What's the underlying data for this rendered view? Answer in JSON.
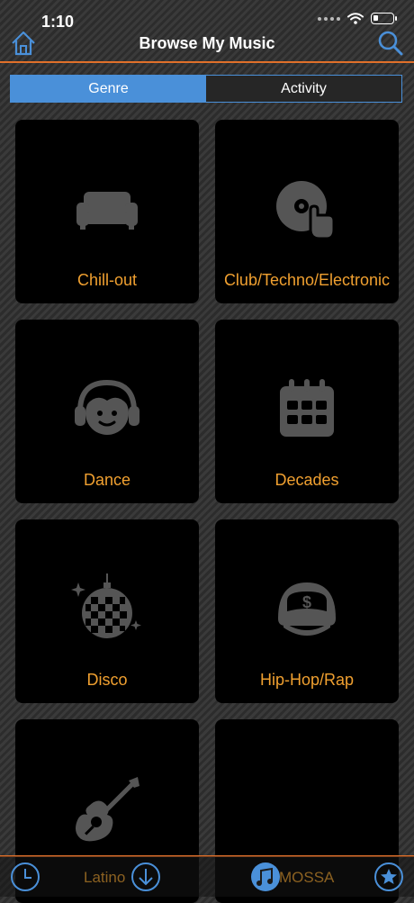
{
  "status_bar": {
    "time": "1:10"
  },
  "nav": {
    "title": "Browse My Music"
  },
  "segmented": {
    "tabs": [
      "Genre",
      "Activity"
    ],
    "selected": "Genre"
  },
  "tiles": [
    {
      "label": "Chill-out",
      "icon": "sofa-icon"
    },
    {
      "label": "Club/Techno/Electronic",
      "icon": "dj-turntable-icon"
    },
    {
      "label": "Dance",
      "icon": "headphones-face-icon"
    },
    {
      "label": "Decades",
      "icon": "calendar-icon"
    },
    {
      "label": "Disco",
      "icon": "disco-ball-icon"
    },
    {
      "label": "Hip-Hop/Rap",
      "icon": "cap-dollar-icon"
    },
    {
      "label": "",
      "icon": "guitar-icon"
    },
    {
      "label": "",
      "icon": ""
    }
  ],
  "bottom_bar": {
    "now_playing_left": "Latino",
    "now_playing_right": "MOSSA"
  },
  "colors": {
    "accent": "#e0702a",
    "label": "#f0a030",
    "segment_active": "#4a90d9"
  }
}
